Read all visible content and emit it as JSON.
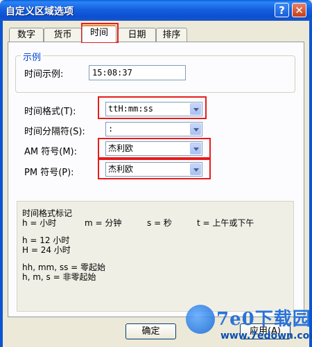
{
  "window": {
    "title": "自定义区域选项",
    "help_glyph": "?",
    "close_glyph": "✕"
  },
  "tabs": [
    {
      "label": "数字"
    },
    {
      "label": "货币"
    },
    {
      "label": "时间"
    },
    {
      "label": "日期"
    },
    {
      "label": "排序"
    }
  ],
  "sample": {
    "legend": "示例",
    "label": "时间示例:",
    "value": "15:08:37"
  },
  "fields": {
    "time_format": {
      "label": "时间格式(T):",
      "value": "ttH:mm:ss"
    },
    "time_separator": {
      "label": "时间分隔符(S):",
      "value": ":"
    },
    "am_symbol": {
      "label": "AM 符号(M):",
      "value": "杰利欧"
    },
    "pm_symbol": {
      "label": "PM 符号(P):",
      "value": "杰利欧"
    }
  },
  "notes": {
    "title": "时间格式标记",
    "legend_h": "h = 小时",
    "legend_m": "m = 分钟",
    "legend_s": "s = 秒",
    "legend_t": "t = 上午或下午",
    "h12": "h = 12 小时",
    "h24": "H = 24 小时",
    "leading_zero": "hh, mm, ss = 零起始",
    "no_leading_zero": "h, m, s = 非零起始"
  },
  "buttons": {
    "ok": "确定",
    "apply": "应用(A)"
  },
  "watermark": {
    "brand": "7e0下载园",
    "url": "www.7edown.com"
  }
}
